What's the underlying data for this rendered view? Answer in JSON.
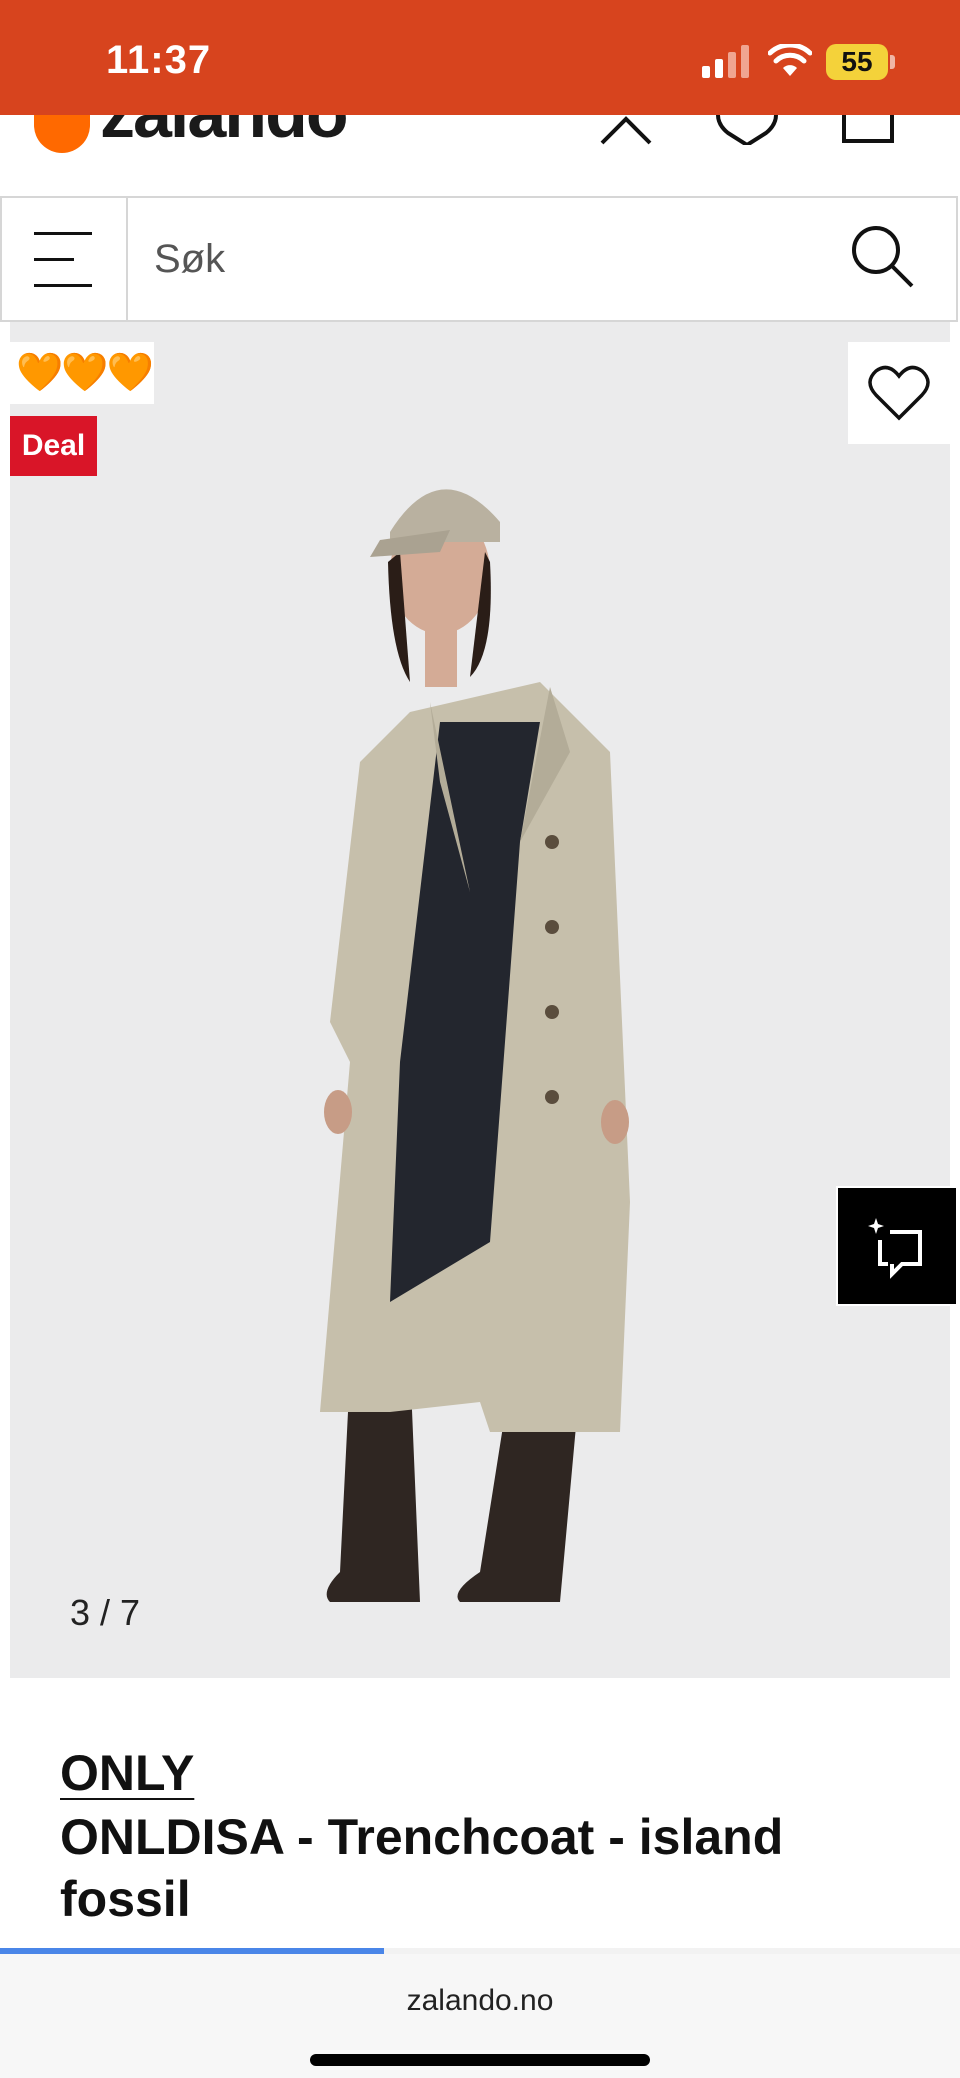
{
  "status_bar": {
    "time": "11:37",
    "battery": "55",
    "background": "#d7441e"
  },
  "header": {
    "logo_text": "zalando",
    "icons": [
      "chevron-up-icon",
      "heart-icon",
      "bag-icon"
    ]
  },
  "search": {
    "placeholder": "Søk"
  },
  "gallery": {
    "hearts": "🧡🧡🧡",
    "deal_label": "Deal",
    "counter": "3 / 7",
    "current_image": 3,
    "total_images": 7
  },
  "product": {
    "brand": "ONLY",
    "name": "ONLDISA - Trenchcoat - island fossil"
  },
  "browser": {
    "url": "zalando.no",
    "load_progress": 0.4
  },
  "colors": {
    "accent": "#ff6900",
    "deal": "#d91528",
    "progress": "#4a86e8"
  }
}
